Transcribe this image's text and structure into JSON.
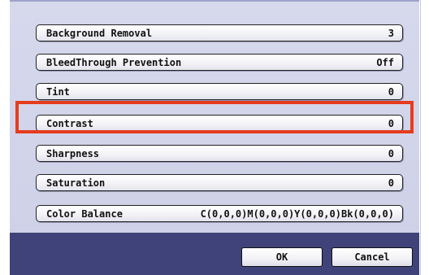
{
  "settings": [
    {
      "label": "Background Removal",
      "value": "3"
    },
    {
      "label": "BleedThrough Prevention",
      "value": "Off"
    },
    {
      "label": "Tint",
      "value": "0"
    },
    {
      "label": "Contrast",
      "value": "0"
    },
    {
      "label": "Sharpness",
      "value": "0"
    },
    {
      "label": "Saturation",
      "value": "0"
    },
    {
      "label": "Color Balance",
      "value": "C(0,0,0)M(0,0,0)Y(0,0,0)Bk(0,0,0)"
    }
  ],
  "buttons": {
    "ok": "OK",
    "cancel": "Cancel"
  },
  "colors": {
    "highlight": "#e63c1e",
    "footer": "#3f4379",
    "list_bg": "#d6d8ec"
  },
  "selected_setting": "Contrast"
}
